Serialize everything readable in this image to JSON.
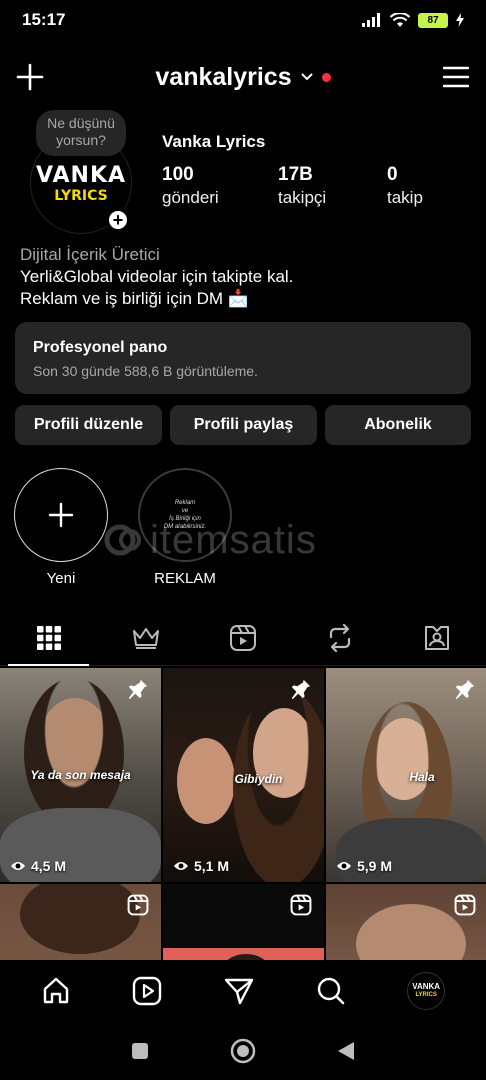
{
  "status": {
    "time": "15:17",
    "battery": "87"
  },
  "header": {
    "username": "vankalyrics"
  },
  "profile": {
    "note": "Ne düşünü yorsun?",
    "avatar_line1": "VANKA",
    "avatar_line2": "LYRICS",
    "display_name": "Vanka Lyrics",
    "stats": [
      {
        "value": "100",
        "label": "gönderi"
      },
      {
        "value": "17B",
        "label": "takipçi"
      },
      {
        "value": "0",
        "label": "takip"
      }
    ],
    "category": "Dijital İçerik Üretici",
    "bio_line1": "Yerli&Global videolar için takipte kal.",
    "bio_line2": "Reklam ve iş birliği için DM 📩"
  },
  "dashboard": {
    "title": "Profesyonel pano",
    "subtitle": "Son 30 günde 588,6 B görüntüleme."
  },
  "buttons": {
    "edit": "Profili düzenle",
    "share": "Profili paylaş",
    "subscription": "Abonelik"
  },
  "highlights": [
    {
      "label": "Yeni"
    },
    {
      "label": "REKLAM",
      "cover_text": [
        "Reklam",
        "ve",
        "İş Birliği için",
        "DM atabilirsiniz."
      ]
    }
  ],
  "watermark": "itemsatis",
  "tabs": [
    "grid-icon",
    "crown-icon",
    "reels-icon",
    "repost-icon",
    "tagged-icon"
  ],
  "posts": [
    {
      "views": "4,5 M",
      "caption": "Ya da son mesaja",
      "pinned": true
    },
    {
      "views": "5,1 M",
      "caption": "Gibiydin",
      "pinned": true
    },
    {
      "views": "5,9 M",
      "caption": "Hala",
      "pinned": true
    },
    {
      "views": "",
      "caption": "",
      "pinned": false
    },
    {
      "views": "",
      "caption": "",
      "pinned": false
    },
    {
      "views": "",
      "caption": "",
      "pinned": false
    }
  ],
  "nav_avatar": {
    "line1": "VANKA",
    "line2": "LYRICS"
  }
}
